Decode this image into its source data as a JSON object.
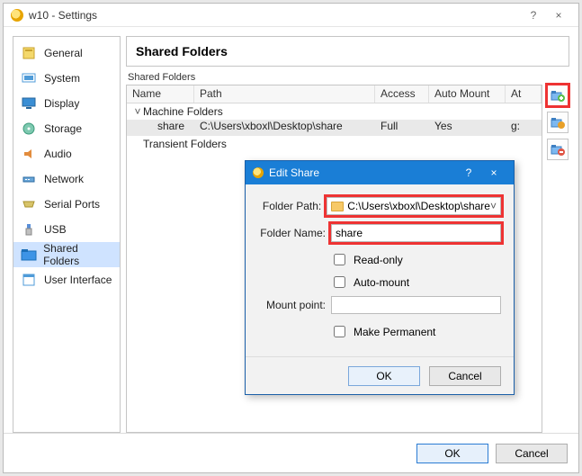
{
  "window": {
    "title": "w10 - Settings",
    "help": "?",
    "close": "×"
  },
  "sidebar": {
    "items": [
      {
        "label": "General"
      },
      {
        "label": "System"
      },
      {
        "label": "Display"
      },
      {
        "label": "Storage"
      },
      {
        "label": "Audio"
      },
      {
        "label": "Network"
      },
      {
        "label": "Serial Ports"
      },
      {
        "label": "USB"
      },
      {
        "label": "Shared Folders"
      },
      {
        "label": "User Interface"
      }
    ]
  },
  "main": {
    "heading": "Shared Folders",
    "group_label": "Shared Folders",
    "columns": {
      "name": "Name",
      "path": "Path",
      "access": "Access",
      "automount": "Auto Mount",
      "at": "At"
    },
    "tree": {
      "machine_folders": "Machine Folders",
      "transient_folders": "Transient Folders"
    },
    "share": {
      "name": "share",
      "path": "C:\\Users\\xboxl\\Desktop\\share",
      "access": "Full",
      "automount": "Yes",
      "at": "g:"
    }
  },
  "dialog": {
    "title": "Edit Share",
    "help": "?",
    "close": "×",
    "labels": {
      "folder_path": "Folder Path:",
      "folder_name": "Folder Name:",
      "read_only": "Read-only",
      "auto_mount": "Auto-mount",
      "mount_point": "Mount point:",
      "make_permanent": "Make Permanent"
    },
    "values": {
      "folder_path": "C:\\Users\\xboxl\\Desktop\\share",
      "folder_name": "share",
      "mount_point": ""
    },
    "buttons": {
      "ok": "OK",
      "cancel": "Cancel"
    }
  },
  "footer": {
    "ok": "OK",
    "cancel": "Cancel"
  }
}
